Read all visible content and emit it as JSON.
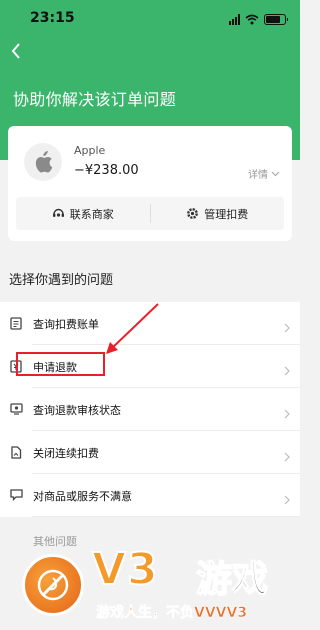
{
  "status_bar": {
    "time": "23:15",
    "battery_level": 0.8
  },
  "header": {
    "title": "协助你解决该订单问题"
  },
  "order": {
    "merchant": "Apple",
    "amount": "−¥238.00",
    "details_label": "详情",
    "actions": [
      {
        "label": "联系商家",
        "icon": "support-icon"
      },
      {
        "label": "管理扣费",
        "icon": "gear-icon"
      }
    ]
  },
  "problems": {
    "title": "选择你遇到的问题",
    "items": [
      {
        "label": "查询扣费账单",
        "icon": "bill-icon"
      },
      {
        "label": "申请退款",
        "icon": "refund-icon"
      },
      {
        "label": "查询退款审核状态",
        "icon": "review-icon"
      },
      {
        "label": "关闭连续扣费",
        "icon": "close-deduct-icon"
      },
      {
        "label": "对商品或服务不满意",
        "icon": "feedback-icon"
      }
    ],
    "partial_item": "其他问题"
  },
  "annotation": {
    "color": "#e8202a"
  },
  "watermark": {
    "brand": "V3",
    "brand_cn": "游戏",
    "slogan": "游戏人生，不负VVVV3"
  },
  "colors": {
    "header_green": "#3bb56b",
    "accent_orange": "#f39a2a"
  }
}
